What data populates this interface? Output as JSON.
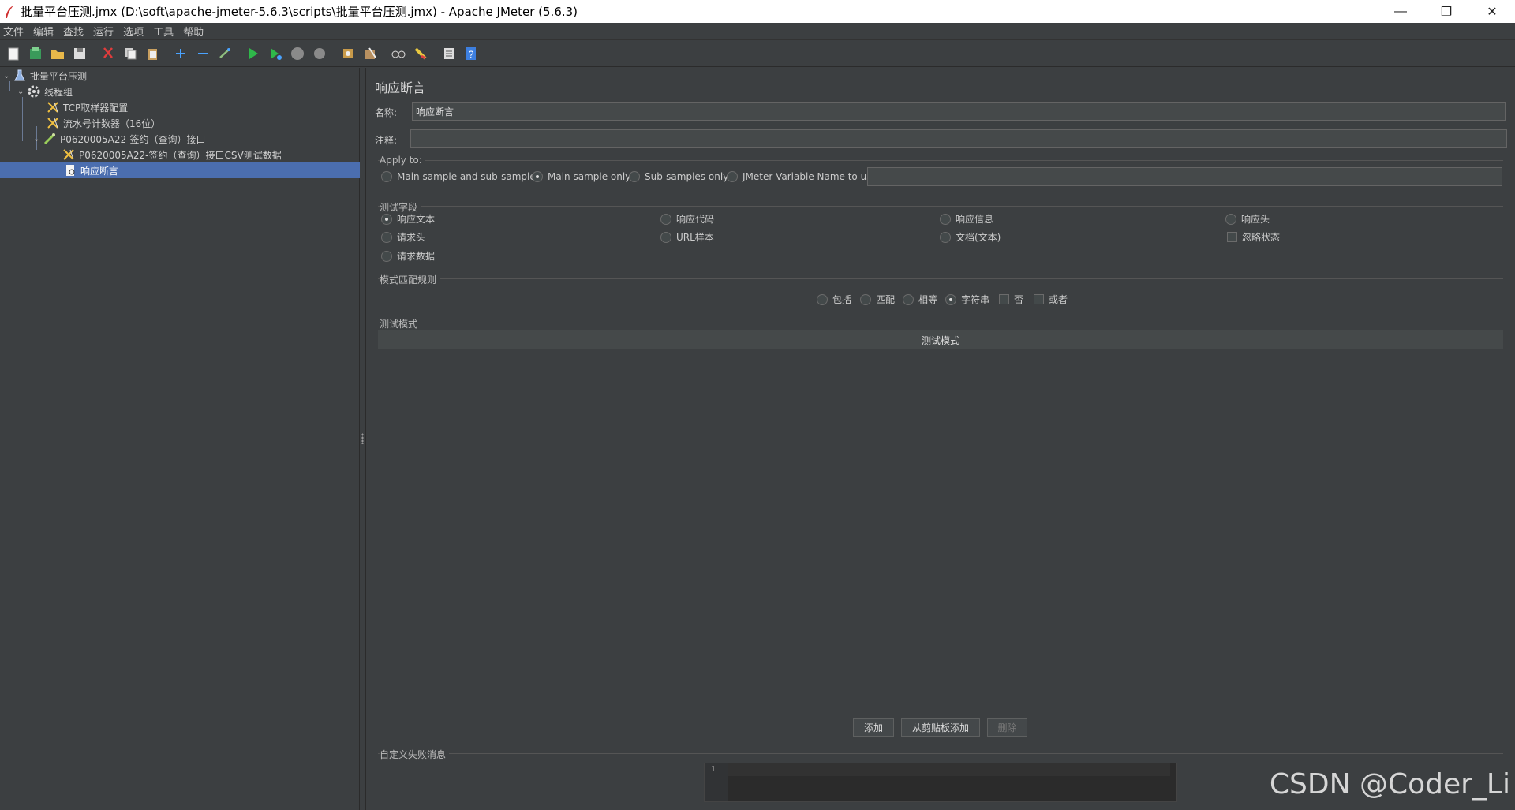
{
  "window": {
    "title": "批量平台压测.jmx (D:\\soft\\apache-jmeter-5.6.3\\scripts\\批量平台压测.jmx) - Apache JMeter (5.6.3)",
    "minimize": "—",
    "maximize": "❐",
    "close": "✕"
  },
  "menu": [
    "文件",
    "编辑",
    "查找",
    "运行",
    "选项",
    "工具",
    "帮助"
  ],
  "toolbar_icons": [
    "new-icon",
    "templates-icon",
    "open-icon",
    "save-icon",
    "cut-icon",
    "copy-icon",
    "paste-icon",
    "expand-icon",
    "collapse-icon",
    "toggle-icon",
    "start-icon",
    "start-no-pause-icon",
    "stop-icon",
    "shutdown-icon",
    "clear-icon",
    "clear-all-icon",
    "search-icon",
    "reset-search-icon",
    "function-helper-icon",
    "help-icon"
  ],
  "tree": [
    {
      "label": "批量平台压测",
      "icon": "test-plan-icon"
    },
    {
      "label": "线程组",
      "icon": "thread-group-icon"
    },
    {
      "label": "TCP取样器配置",
      "icon": "config-element-icon"
    },
    {
      "label": "流水号计数器（16位）",
      "icon": "config-element-icon"
    },
    {
      "label": "P0620005A22-签约（查询）接口",
      "icon": "sampler-icon"
    },
    {
      "label": "P0620005A22-签约（查询）接口CSV测试数据",
      "icon": "config-element-icon"
    },
    {
      "label": "响应断言",
      "icon": "assertion-icon"
    }
  ],
  "panel": {
    "title": "响应断言",
    "name_label": "名称:",
    "name_value": "响应断言",
    "comment_label": "注释:",
    "comment_value": ""
  },
  "apply_to": {
    "label": "Apply to:",
    "options": [
      "Main sample and sub-samples",
      "Main sample only",
      "Sub-samples only",
      "JMeter Variable Name to use"
    ],
    "selected": "Main sample only",
    "variable_value": ""
  },
  "test_field": {
    "label": "测试字段",
    "options": [
      "响应文本",
      "响应代码",
      "响应信息",
      "响应头",
      "请求头",
      "URL样本",
      "文档(文本)",
      "忽略状态",
      "请求数据"
    ],
    "selected": "响应文本",
    "ignore_status": false
  },
  "pattern_rules": {
    "label": "模式匹配规则",
    "options": [
      "包括",
      "匹配",
      "相等",
      "字符串"
    ],
    "selected": "字符串",
    "not_label": "否",
    "or_label": "或者",
    "not_checked": false,
    "or_checked": false
  },
  "test_patterns": {
    "label": "测试模式",
    "column_header": "测试模式",
    "rows": []
  },
  "buttons": {
    "add": "添加",
    "add_from_clipboard": "从剪贴板添加",
    "delete": "删除"
  },
  "custom_failure": {
    "label": "自定义失败消息",
    "line_number": "1",
    "value": ""
  },
  "watermark": "CSDN @Coder_Li"
}
